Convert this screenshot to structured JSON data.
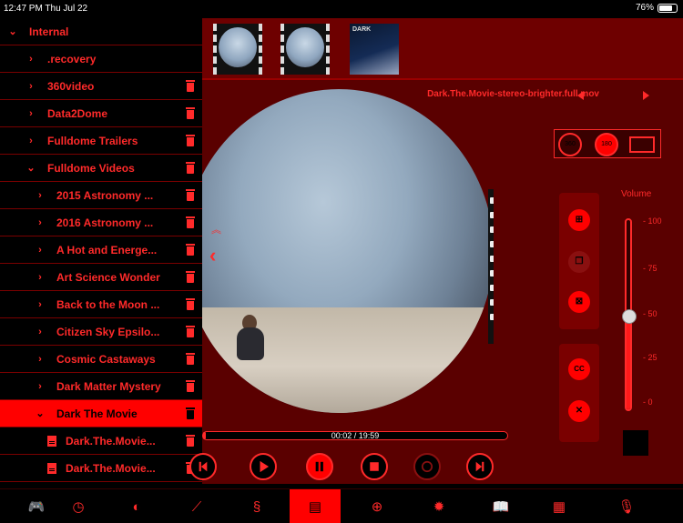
{
  "status_bar": {
    "time": "12:47 PM  Thu Jul 22",
    "battery": "76%"
  },
  "sidebar": {
    "items": [
      {
        "label": "Internal",
        "chevron": "⌄",
        "trash": false,
        "indent": 0,
        "selected": false
      },
      {
        "label": ".recovery",
        "chevron": "›",
        "trash": false,
        "indent": 1,
        "selected": false
      },
      {
        "label": "360video",
        "chevron": "›",
        "trash": true,
        "indent": 1,
        "selected": false
      },
      {
        "label": "Data2Dome",
        "chevron": "›",
        "trash": true,
        "indent": 1,
        "selected": false
      },
      {
        "label": "Fulldome Trailers",
        "chevron": "›",
        "trash": true,
        "indent": 1,
        "selected": false
      },
      {
        "label": "Fulldome Videos",
        "chevron": "⌄",
        "trash": true,
        "indent": 1,
        "selected": false
      },
      {
        "label": "2015 Astronomy ...",
        "chevron": "›",
        "trash": true,
        "indent": 2,
        "selected": false
      },
      {
        "label": "2016 Astronomy ...",
        "chevron": "›",
        "trash": true,
        "indent": 2,
        "selected": false
      },
      {
        "label": "A Hot and Energe...",
        "chevron": "›",
        "trash": true,
        "indent": 2,
        "selected": false
      },
      {
        "label": "Art Science Wonder",
        "chevron": "›",
        "trash": true,
        "indent": 2,
        "selected": false
      },
      {
        "label": "Back to the Moon ...",
        "chevron": "›",
        "trash": true,
        "indent": 2,
        "selected": false
      },
      {
        "label": "Citizen Sky Epsilo...",
        "chevron": "›",
        "trash": true,
        "indent": 2,
        "selected": false
      },
      {
        "label": "Cosmic Castaways",
        "chevron": "›",
        "trash": true,
        "indent": 2,
        "selected": false
      },
      {
        "label": "Dark Matter Mystery",
        "chevron": "›",
        "trash": true,
        "indent": 2,
        "selected": false
      },
      {
        "label": "Dark The Movie",
        "chevron": "⌄",
        "trash": true,
        "indent": 2,
        "selected": true
      },
      {
        "label": "Dark.The.Movie...",
        "chevron": "",
        "file": true,
        "trash": true,
        "indent": 3,
        "selected": false
      },
      {
        "label": "Dark.The.Movie...",
        "chevron": "",
        "file": true,
        "trash": true,
        "indent": 3,
        "selected": false
      }
    ]
  },
  "thumbnails": [
    {
      "name": "fisheye-thumb-1",
      "kind": "fisheye"
    },
    {
      "name": "fisheye-thumb-2",
      "kind": "fisheye"
    },
    {
      "name": "dark-movie-thumb",
      "kind": "poster",
      "text": "DARK"
    }
  ],
  "viewer": {
    "filename": "Dark.The.Movie-stereo-brighter.full.mov",
    "mode_buttons": [
      "360",
      "180"
    ],
    "volume_label": "Volume",
    "volume_ticks": [
      "- 100",
      "- 75",
      "- 50",
      "- 25",
      "- 0"
    ],
    "volume_level": 0.5,
    "cc_label": "CC"
  },
  "playback": {
    "time": "00:02 / 19:59",
    "progress_fraction": 0.0017
  },
  "tabs": [
    {
      "name": "tab-gamepad",
      "icon": "gamepad-icon",
      "glyph": "🎮",
      "active": false
    },
    {
      "name": "tab-clock",
      "icon": "clock-icon",
      "glyph": "◷",
      "active": false
    },
    {
      "name": "tab-planet",
      "icon": "planet-icon",
      "glyph": "◐",
      "active": false
    },
    {
      "name": "tab-constellation",
      "icon": "constellation-icon",
      "glyph": "⟋",
      "active": false
    },
    {
      "name": "tab-s-curve",
      "icon": "s-curve-icon",
      "glyph": "§",
      "active": false
    },
    {
      "name": "tab-film",
      "icon": "film-icon",
      "glyph": "▤",
      "active": true
    },
    {
      "name": "tab-globe",
      "icon": "globe-icon",
      "glyph": "⊕",
      "active": false
    },
    {
      "name": "tab-settings",
      "icon": "gear-icon",
      "glyph": "✹",
      "active": false
    },
    {
      "name": "tab-book",
      "icon": "book-icon",
      "glyph": "📖",
      "active": false
    },
    {
      "name": "tab-keyboard",
      "icon": "keyboard-icon",
      "glyph": "▦",
      "active": false
    },
    {
      "name": "tab-microphone",
      "icon": "microphone-icon",
      "glyph": "🎙",
      "active": false
    }
  ],
  "colors": {
    "accent": "#ff0000",
    "panel": "#5a0000",
    "text": "#ff2a2a"
  }
}
